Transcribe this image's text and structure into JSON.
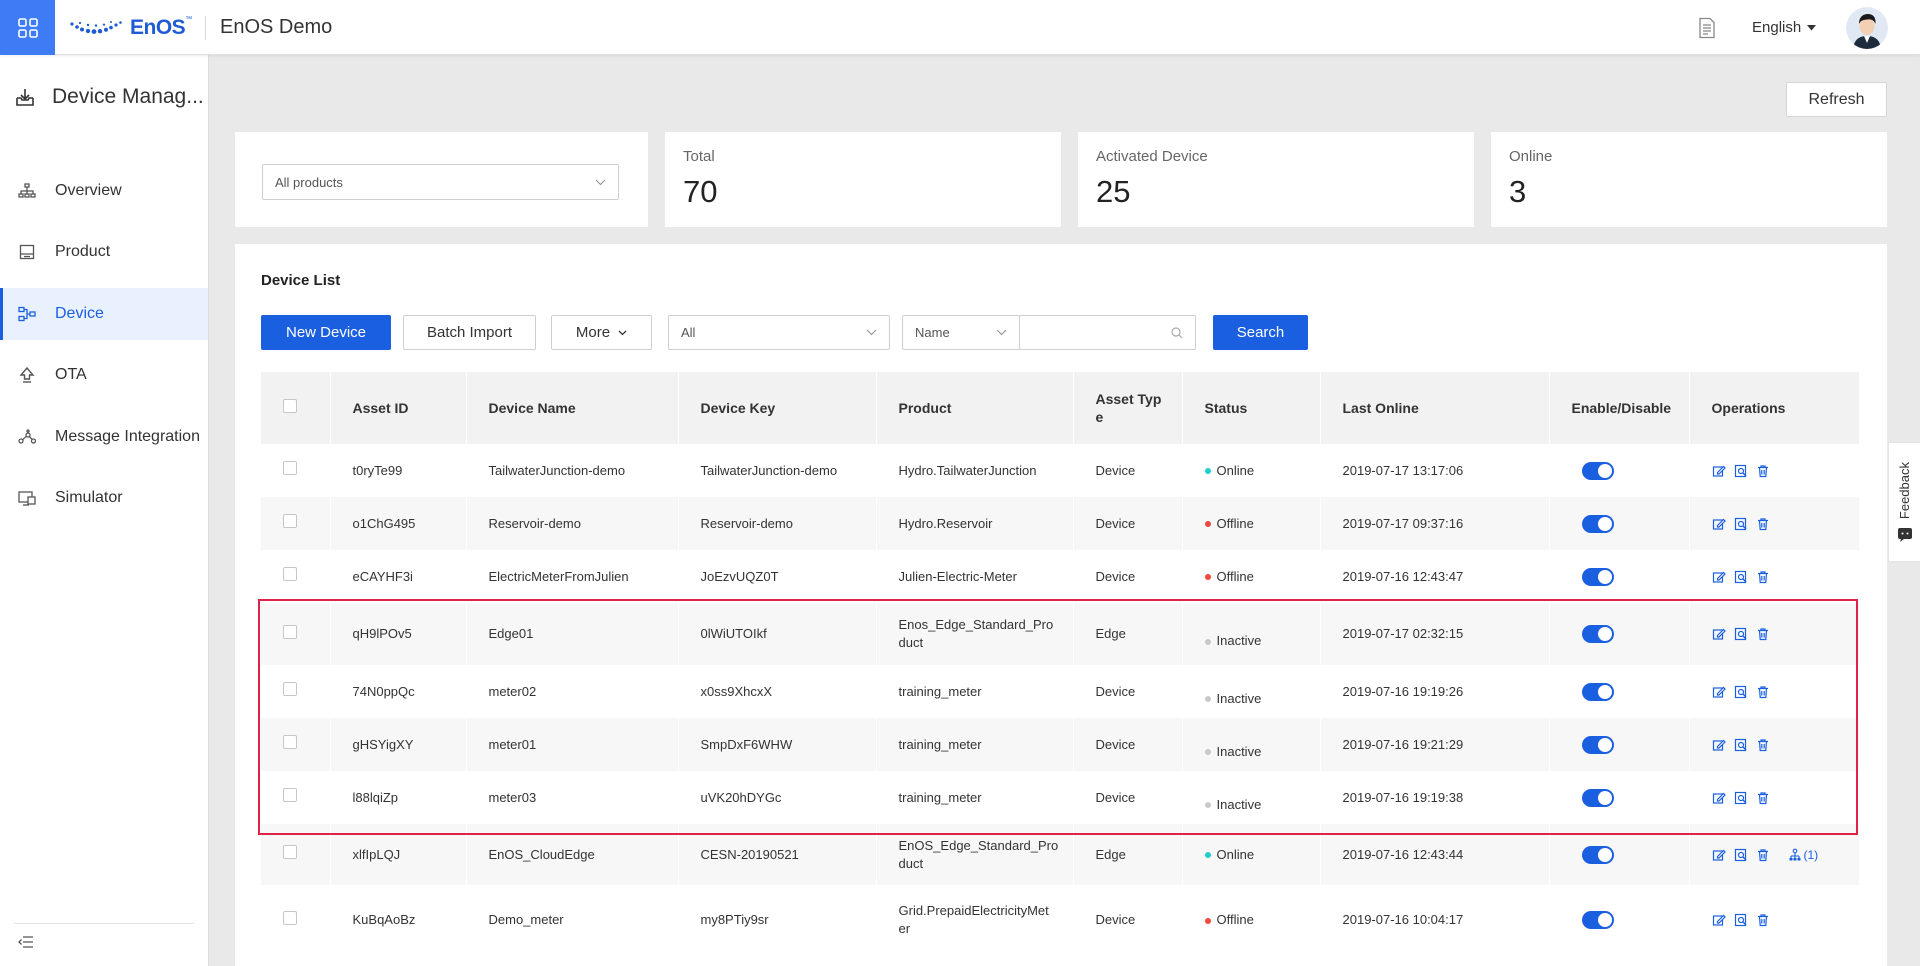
{
  "header": {
    "brand": "EnOS",
    "brand_tm": "™",
    "app_title": "EnOS Demo",
    "language": "English"
  },
  "sidebar": {
    "title": "Device Manag...",
    "items": [
      {
        "label": "Overview",
        "icon": "sitemap-icon"
      },
      {
        "label": "Product",
        "icon": "product-icon"
      },
      {
        "label": "Device",
        "icon": "device-icon",
        "active": true
      },
      {
        "label": "OTA",
        "icon": "upload-icon"
      },
      {
        "label": "Message Integration",
        "icon": "share-icon"
      },
      {
        "label": "Simulator",
        "icon": "simulator-icon"
      }
    ]
  },
  "toolbar": {
    "refresh_label": "Refresh"
  },
  "filter": {
    "product_select": "All products"
  },
  "stats": {
    "total_label": "Total",
    "total_value": "70",
    "activated_label": "Activated Device",
    "activated_value": "25",
    "online_label": "Online",
    "online_value": "3"
  },
  "device_list": {
    "title": "Device List",
    "new_device_label": "New Device",
    "batch_import_label": "Batch Import",
    "more_label": "More",
    "status_filter": "All",
    "search_field": "Name",
    "search_value": "",
    "search_button": "Search",
    "columns": [
      "Asset ID",
      "Device Name",
      "Device Key",
      "Product",
      "Asset Typ\ne",
      "Status",
      "Last Online",
      "Enable/Disable",
      "Operations"
    ],
    "rows": [
      {
        "asset_id": "t0ryTe99",
        "device_name": "TailwaterJunction-demo",
        "device_key": "TailwaterJunction-demo",
        "product": "Hydro.TailwaterJunction",
        "asset_type": "Device",
        "status": "Online",
        "last_online": "2019-07-17 13:17:06",
        "enabled": true,
        "extra_op": ""
      },
      {
        "asset_id": "o1ChG495",
        "device_name": "Reservoir-demo",
        "device_key": "Reservoir-demo",
        "product": "Hydro.Reservoir",
        "asset_type": "Device",
        "status": "Offline",
        "last_online": "2019-07-17 09:37:16",
        "enabled": true,
        "extra_op": ""
      },
      {
        "asset_id": "eCAYHF3i",
        "device_name": "ElectricMeterFromJulien",
        "device_key": "JoEzvUQZ0T",
        "product": "Julien-Electric-Meter",
        "asset_type": "Device",
        "status": "Offline",
        "last_online": "2019-07-16 12:43:47",
        "enabled": true,
        "extra_op": ""
      },
      {
        "asset_id": "qH9lPOv5",
        "device_name": "Edge01",
        "device_key": "0lWiUTOIkf",
        "product": "Enos_Edge_Standard_Pro\nduct",
        "asset_type": "Edge",
        "status": "Inactive",
        "last_online": "2019-07-17 02:32:15",
        "enabled": true,
        "extra_op": ""
      },
      {
        "asset_id": "74N0ppQc",
        "device_name": "meter02",
        "device_key": "x0ss9XhcxX",
        "product": "training_meter",
        "asset_type": "Device",
        "status": "Inactive",
        "last_online": "2019-07-16 19:19:26",
        "enabled": true,
        "extra_op": ""
      },
      {
        "asset_id": "gHSYigXY",
        "device_name": "meter01",
        "device_key": "SmpDxF6WHW",
        "product": "training_meter",
        "asset_type": "Device",
        "status": "Inactive",
        "last_online": "2019-07-16 19:21:29",
        "enabled": true,
        "extra_op": ""
      },
      {
        "asset_id": "l88lqiZp",
        "device_name": "meter03",
        "device_key": "uVK20hDYGc",
        "product": "training_meter",
        "asset_type": "Device",
        "status": "Inactive",
        "last_online": "2019-07-16 19:19:38",
        "enabled": true,
        "extra_op": ""
      },
      {
        "asset_id": "xlfIpLQJ",
        "device_name": "EnOS_CloudEdge",
        "device_key": "CESN-20190521",
        "product": "EnOS_Edge_Standard_Pro\nduct",
        "asset_type": "Edge",
        "status": "Online",
        "last_online": "2019-07-16 12:43:44",
        "enabled": true,
        "extra_op": "(1)"
      },
      {
        "asset_id": "KuBqAoBz",
        "device_name": "Demo_meter",
        "device_key": "my8PTiy9sr",
        "product": "Grid.PrepaidElectricityMet\ner",
        "asset_type": "Device",
        "status": "Offline",
        "last_online": "2019-07-16 10:04:17",
        "enabled": true,
        "extra_op": ""
      }
    ]
  },
  "status_colors": {
    "Online": "#1ccfc9",
    "Offline": "#f0483e",
    "Inactive": "#c8c8c8"
  },
  "feedback": {
    "label": "Feedback"
  }
}
